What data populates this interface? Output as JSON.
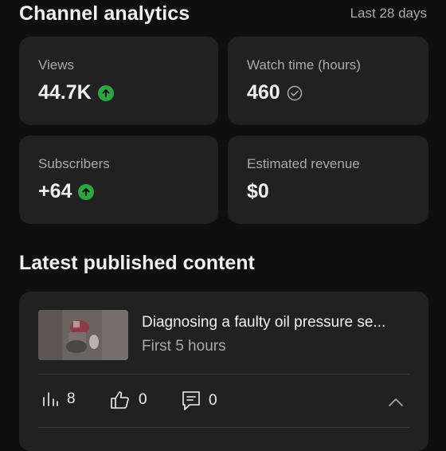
{
  "header": {
    "title": "Channel analytics",
    "range": "Last 28 days"
  },
  "metrics": [
    {
      "label": "Views",
      "value": "44.7K",
      "indicator": "up-arrow-icon"
    },
    {
      "label": "Watch time (hours)",
      "value": "460",
      "indicator": "check-circle-icon"
    },
    {
      "label": "Subscribers",
      "value": "+64",
      "indicator": "up-arrow-icon"
    },
    {
      "label": "Estimated revenue",
      "value": "$0",
      "indicator": ""
    }
  ],
  "latest": {
    "section_title": "Latest published content",
    "video": {
      "title": "Diagnosing a faulty oil pressure se...",
      "subtitle": "First 5 hours",
      "views": "8",
      "likes": "0",
      "comments": "0"
    }
  },
  "colors": {
    "background": "#0f0f0f",
    "card": "#212121",
    "accent_green": "#2ba640",
    "muted_text": "#aaaaaa"
  }
}
